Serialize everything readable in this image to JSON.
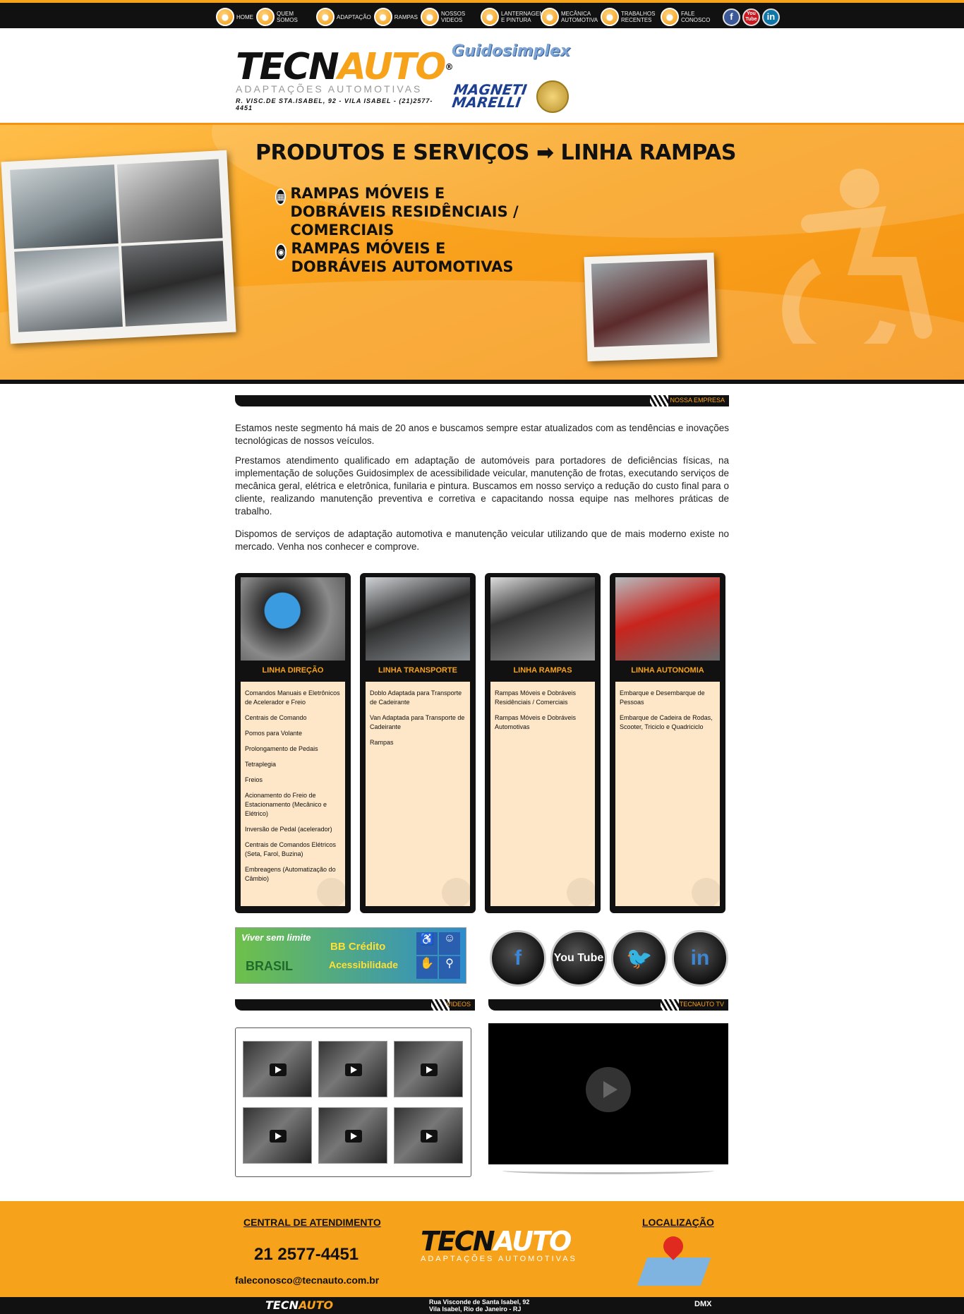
{
  "nav": {
    "items": [
      {
        "label": "HOME",
        "icon": "home-icon"
      },
      {
        "label": "QUEM SOMOS",
        "icon": "people-icon"
      },
      {
        "label": "ADAPTAÇÃO",
        "icon": "wheelchair-icon"
      },
      {
        "label": "RAMPAS",
        "icon": "ramp-icon"
      },
      {
        "label": "NOSSOS VIDEOS",
        "icon": "video-icon"
      },
      {
        "label": "LANTERNAGEM E PINTURA",
        "icon": "car-icon"
      },
      {
        "label": "MECÂNICA AUTOMOTIVA",
        "icon": "gear-icon"
      },
      {
        "label": "TRABALHOS RECENTES",
        "icon": "tools-icon"
      },
      {
        "label": "FALE CONOSCO",
        "icon": "phone-icon"
      }
    ],
    "social": [
      {
        "label": "f",
        "icon": "facebook-icon",
        "color": "#3b5998"
      },
      {
        "label": "You Tube",
        "icon": "youtube-icon",
        "color": "#cc181e"
      },
      {
        "label": "in",
        "icon": "linkedin-icon",
        "color": "#0e76a8"
      }
    ]
  },
  "header": {
    "logo_title_a": "TECN",
    "logo_title_b": "AUTO",
    "logo_reg": "®",
    "logo_sub": "ADAPTAÇÕES AUTOMOTIVAS",
    "address": "R. VISC.DE STA.ISABEL, 92 - VILA ISABEL - (21)2577-4451",
    "brand1": "Guidosimplex",
    "brand2_a": "MAGNETI",
    "brand2_b": "MARELLI"
  },
  "banner": {
    "title": "PRODUTOS E SERVIÇOS ➡ LINHA RAMPAS",
    "item1": "RAMPAS MÓVEIS E DOBRÁVEIS RESIDÊNCIAIS / COMERCIAIS",
    "item2": "RAMPAS MÓVEIS E DOBRÁVEIS AUTOMOTIVAS"
  },
  "about": {
    "tag": "NOSSA EMPRESA",
    "p1": "Estamos neste segmento há mais de 20 anos e buscamos sempre estar atualizados com as tendências e inovações tecnológicas de nossos veículos.",
    "p2": "Prestamos atendimento qualificado em adaptação de automóveis para portadores de deficiências físicas, na implementação de soluções Guidosimplex de acessibilidade veicular, manutenção de frotas, executando serviços de mecânica geral, elétrica e eletrônica, funilaria e pintura. Buscamos em nosso serviço a redução do custo final para o cliente, realizando manutenção preventiva e corretiva e capacitando nossa equipe nas melhores práticas de trabalho.",
    "p3": "Dispomos de serviços de adaptação automotiva e manutenção veicular utilizando que de mais moderno existe no mercado. Venha nos conhecer e comprove."
  },
  "cards": [
    {
      "title": "LINHA DIREÇÃO",
      "items": [
        "Comandos Manuais e Eletrônicos de Acelerador e Freio",
        "Centrais de Comando",
        "Pomos para Volante",
        "Prolongamento de Pedais",
        "Tetraplegia",
        "Freios",
        "Acionamento do Freio de Estacionamento (Mecânico e Elétrico)",
        "Inversão de Pedal (acelerador)",
        "Centrais de Comandos Elétricos (Seta, Farol, Buzina)",
        "Embreagens (Automatização do Câmbio)"
      ]
    },
    {
      "title": "LINHA TRANSPORTE",
      "items": [
        "Doblo Adaptada para Transporte de Cadeirante",
        "Van Adaptada para Transporte de Cadeirante",
        "Rampas"
      ]
    },
    {
      "title": "LINHA RAMPAS",
      "items": [
        "Rampas Móveis e Dobráveis Residênciais / Comerciais",
        "Rampas Móveis e Dobráveis Automotivas"
      ]
    },
    {
      "title": "LINHA AUTONOMIA",
      "items": [
        "Embarque e Desembarque de Pessoas",
        "Embarque de Cadeira de Rodas, Scooter, Triciclo e Quadriciclo"
      ]
    }
  ],
  "bb": {
    "line1": "Viver sem limite",
    "line2": "BB Crédito",
    "line3": "Acessibilidade",
    "line4": "BRASIL"
  },
  "social_big": [
    {
      "label": "f",
      "icon": "facebook-icon",
      "color": "#3b86d6"
    },
    {
      "label": "You Tube",
      "icon": "youtube-icon",
      "color": "#fff"
    },
    {
      "label": "🐦",
      "icon": "twitter-icon",
      "color": "#3fb0e8"
    },
    {
      "label": "in",
      "icon": "linkedin-icon",
      "color": "#3b86d6"
    }
  ],
  "videos": {
    "tag": "VIDEOS"
  },
  "tv": {
    "tag": "TECNAUTO TV"
  },
  "footer": {
    "central_title": "CENTRAL DE ATENDIMENTO",
    "phone": "21 2577-4451",
    "email": "faleconosco@tecnauto.com.br",
    "location_title": "LOCALIZAÇÃO",
    "addr1": "Rua Visconde de Santa Isabel, 92",
    "addr2": "Vila Isabel, Rio de Janeiro - RJ",
    "dmx": "DMX"
  }
}
